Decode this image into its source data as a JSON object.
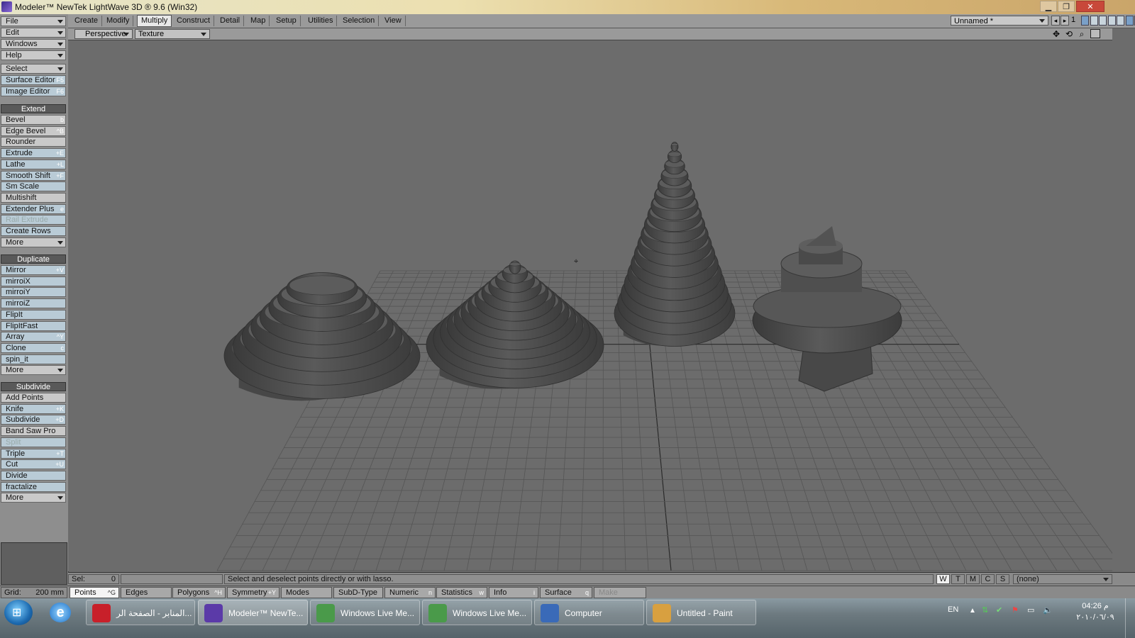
{
  "window": {
    "title": "Modeler™ NewTek LightWave 3D ® 9.6  (Win32)"
  },
  "menus": [
    {
      "label": "File"
    },
    {
      "label": "Edit"
    },
    {
      "label": "Windows"
    },
    {
      "label": "Help"
    }
  ],
  "select_menu": "Select",
  "editors": [
    {
      "label": "Surface Editor",
      "shortcut": "F5"
    },
    {
      "label": "Image Editor",
      "shortcut": "F6"
    }
  ],
  "extend": {
    "header": "Extend",
    "items": [
      {
        "label": "Bevel",
        "shortcut": "b",
        "blue": false,
        "disabled": false
      },
      {
        "label": "Edge Bevel",
        "shortcut": "^B",
        "blue": false,
        "disabled": false
      },
      {
        "label": "Rounder",
        "shortcut": "",
        "blue": false,
        "disabled": false
      },
      {
        "label": "Extrude",
        "shortcut": "+E",
        "blue": true,
        "disabled": false
      },
      {
        "label": "Lathe",
        "shortcut": "+L",
        "blue": true,
        "disabled": false
      },
      {
        "label": "Smooth Shift",
        "shortcut": "+F",
        "blue": true,
        "disabled": false
      },
      {
        "label": "Sm Scale",
        "shortcut": "",
        "blue": true,
        "disabled": false
      },
      {
        "label": "Multishift",
        "shortcut": "",
        "blue": false,
        "disabled": false
      },
      {
        "label": "Extender Plus",
        "shortcut": "e",
        "blue": true,
        "disabled": false
      },
      {
        "label": "Rail Extrude",
        "shortcut": "",
        "blue": true,
        "disabled": true
      },
      {
        "label": "Create Rows",
        "shortcut": "",
        "blue": true,
        "disabled": false
      }
    ],
    "more": "More"
  },
  "duplicate": {
    "header": "Duplicate",
    "items": [
      {
        "label": "Mirror",
        "shortcut": "+V",
        "blue": true,
        "disabled": false
      },
      {
        "label": "mirroiX",
        "shortcut": "",
        "blue": true,
        "disabled": false
      },
      {
        "label": "mirroiY",
        "shortcut": "",
        "blue": true,
        "disabled": false
      },
      {
        "label": "mirroiZ",
        "shortcut": "",
        "blue": true,
        "disabled": false
      },
      {
        "label": "FlipIt",
        "shortcut": "",
        "blue": true,
        "disabled": false
      },
      {
        "label": "FlipItFast",
        "shortcut": "",
        "blue": true,
        "disabled": false
      },
      {
        "label": "Array",
        "shortcut": "^Y",
        "blue": true,
        "disabled": false
      },
      {
        "label": "Clone",
        "shortcut": "c",
        "blue": true,
        "disabled": false
      },
      {
        "label": "spin_it",
        "shortcut": "",
        "blue": true,
        "disabled": false
      }
    ],
    "more": "More"
  },
  "subdivide": {
    "header": "Subdivide",
    "items": [
      {
        "label": "Add Points",
        "shortcut": "",
        "blue": false,
        "disabled": false
      },
      {
        "label": "Knife",
        "shortcut": "+K",
        "blue": true,
        "disabled": false
      },
      {
        "label": "Subdivide",
        "shortcut": "+D",
        "blue": true,
        "disabled": false
      },
      {
        "label": "Band Saw Pro",
        "shortcut": "",
        "blue": false,
        "disabled": false
      },
      {
        "label": "Split",
        "shortcut": "",
        "blue": true,
        "disabled": true
      },
      {
        "label": "Triple",
        "shortcut": "+T",
        "blue": true,
        "disabled": false
      },
      {
        "label": "Cut",
        "shortcut": "+U",
        "blue": true,
        "disabled": false
      },
      {
        "label": "Divide",
        "shortcut": "",
        "blue": true,
        "disabled": false
      },
      {
        "label": "fractalize",
        "shortcut": "",
        "blue": true,
        "disabled": false
      }
    ],
    "more": "More"
  },
  "tabs": [
    {
      "label": "Create",
      "active": false
    },
    {
      "label": "Modify",
      "active": false
    },
    {
      "label": "Multiply",
      "active": true
    },
    {
      "label": "Construct",
      "active": false
    },
    {
      "label": "Detail",
      "active": false
    },
    {
      "label": "Map",
      "active": false
    },
    {
      "label": "Setup",
      "active": false
    },
    {
      "label": "Utilities",
      "active": false
    },
    {
      "label": "Selection",
      "active": false
    },
    {
      "label": "View",
      "active": false
    }
  ],
  "object_selector": "Unnamed *",
  "layer_number": "1",
  "viewport": {
    "view": "Perspective",
    "render_mode": "Texture"
  },
  "status": {
    "sel_label": "Sel:",
    "sel_value": "0",
    "message": "Select and deselect points directly or with lasso.",
    "wtmcs": [
      "W",
      "T",
      "M",
      "C",
      "S"
    ],
    "surface_value": "(none)"
  },
  "bottombar": {
    "grid_label": "Grid:",
    "grid_value": "200 mm",
    "buttons": [
      {
        "label": "Points",
        "shortcut": "^G",
        "selected": true,
        "disabled": false
      },
      {
        "label": "Edges",
        "shortcut": "",
        "selected": false,
        "disabled": false
      },
      {
        "label": "Polygons",
        "shortcut": "^H",
        "selected": false,
        "disabled": false
      },
      {
        "label": "Symmetry",
        "shortcut": "+Y",
        "selected": false,
        "disabled": false
      },
      {
        "label": "Modes",
        "shortcut": "",
        "selected": false,
        "disabled": false
      },
      {
        "label": "SubD-Type",
        "shortcut": "",
        "selected": false,
        "disabled": false
      },
      {
        "label": "Numeric",
        "shortcut": "n",
        "selected": false,
        "disabled": false
      },
      {
        "label": "Statistics",
        "shortcut": "w",
        "selected": false,
        "disabled": false
      },
      {
        "label": "Info",
        "shortcut": "i",
        "selected": false,
        "disabled": false
      },
      {
        "label": "Surface",
        "shortcut": "q",
        "selected": false,
        "disabled": false
      },
      {
        "label": "Make",
        "shortcut": "",
        "selected": false,
        "disabled": true
      }
    ]
  },
  "taskbar": {
    "items": [
      {
        "label": "المنابر - الصفحة الر...",
        "icon": "opera-icon",
        "color": "#c8202a",
        "active": false
      },
      {
        "label": "Modeler™ NewTe...",
        "icon": "lightwave-icon",
        "color": "#5b3aa8",
        "active": true
      },
      {
        "label": "Windows Live Me...",
        "icon": "messenger-icon",
        "color": "#4a9a4a",
        "active": false
      },
      {
        "label": "Windows Live Me...",
        "icon": "messenger-icon",
        "color": "#4a9a4a",
        "active": false
      },
      {
        "label": "Computer",
        "icon": "computer-icon",
        "color": "#3a6ab8",
        "active": false
      },
      {
        "label": "Untitled - Paint",
        "icon": "paint-icon",
        "color": "#d8a040",
        "active": false
      }
    ],
    "language": "EN",
    "time": "04:26 م",
    "date": "٢٠١٠/٠٦/٠٩"
  }
}
